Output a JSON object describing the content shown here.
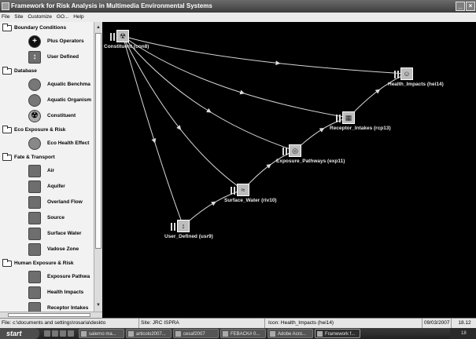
{
  "window": {
    "title": "Framework for Risk Analysis in Multimedia Environmental Systems"
  },
  "menu": [
    "File",
    "Site",
    "Customize",
    "GO...",
    "Help"
  ],
  "sidebar": {
    "groups": [
      {
        "label": "Boundary Conditions",
        "items": [
          {
            "label": "Plus Operators",
            "icon": "plus-icon"
          },
          {
            "label": "User Defined",
            "icon": "user-defined-icon"
          }
        ]
      },
      {
        "label": "Database",
        "items": [
          {
            "label": "Aquatic Benchma",
            "icon": "aquatic-benchmark-icon"
          },
          {
            "label": "Aquatic Organism",
            "icon": "aquatic-organism-icon"
          },
          {
            "label": "Constituent",
            "icon": "constituent-icon"
          }
        ]
      },
      {
        "label": "Eco Exposure & Risk",
        "items": [
          {
            "label": "Eco Health Effect",
            "icon": "eco-health-icon"
          }
        ]
      },
      {
        "label": "Fate & Transport",
        "items": [
          {
            "label": "Air",
            "icon": "air-icon"
          },
          {
            "label": "Aquifer",
            "icon": "aquifer-icon"
          },
          {
            "label": "Overland Flow",
            "icon": "overland-flow-icon"
          },
          {
            "label": "Source",
            "icon": "source-icon"
          },
          {
            "label": "Surface Water",
            "icon": "surface-water-icon"
          },
          {
            "label": "Vadose Zone",
            "icon": "vadose-zone-icon"
          }
        ]
      },
      {
        "label": "Human Exposure & Risk",
        "items": [
          {
            "label": "Exposure Pathwa",
            "icon": "exposure-pathway-icon"
          },
          {
            "label": "Health Impacts",
            "icon": "health-impacts-icon"
          },
          {
            "label": "Receptor Intakes",
            "icon": "receptor-intakes-icon"
          }
        ]
      }
    ]
  },
  "nodes": [
    {
      "id": "con8",
      "label": "Constituent (con8)",
      "icon": "constituent-icon"
    },
    {
      "id": "hei14",
      "label": "Health_Impacts (hei14)",
      "icon": "health-impacts-icon"
    },
    {
      "id": "rcp13",
      "label": "Receptor_Intakes (rcp13)",
      "icon": "receptor-intakes-icon"
    },
    {
      "id": "exp11",
      "label": "Exposure_Pathways (exp11)",
      "icon": "exposure-pathway-icon"
    },
    {
      "id": "riv10",
      "label": "Surface_Water (riv10)",
      "icon": "surface-water-icon"
    },
    {
      "id": "usr9",
      "label": "User_Defined (usr9)",
      "icon": "user-defined-icon"
    }
  ],
  "edges": [
    [
      "con8",
      "usr9"
    ],
    [
      "con8",
      "riv10"
    ],
    [
      "con8",
      "exp11"
    ],
    [
      "con8",
      "rcp13"
    ],
    [
      "con8",
      "hei14"
    ],
    [
      "usr9",
      "riv10"
    ],
    [
      "riv10",
      "exp11"
    ],
    [
      "exp11",
      "rcp13"
    ],
    [
      "rcp13",
      "hei14"
    ]
  ],
  "status": {
    "file": "File: c:\\documents and settings\\rosaria\\deskto",
    "site": "Site: JRC ISPRA",
    "icon": "Icon: Health_Impacts (hei14)",
    "date": "09/03/2007",
    "time": "18.12"
  },
  "taskbar": {
    "start": "start",
    "tasks": [
      {
        "label": "salerno ma...",
        "active": false
      },
      {
        "label": "articolo2007...",
        "active": false
      },
      {
        "label": "cesaf2007",
        "active": false
      },
      {
        "label": "FEBACK# 0...",
        "active": false
      },
      {
        "label": "Adobe Acro...",
        "active": false
      },
      {
        "label": "Framework f...",
        "active": true
      }
    ],
    "clock": "18"
  }
}
